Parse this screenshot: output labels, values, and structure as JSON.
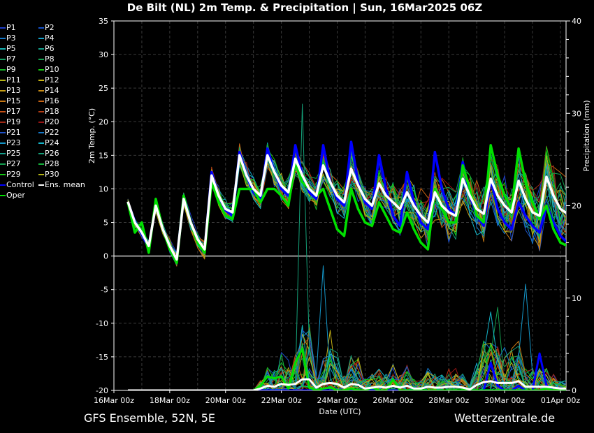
{
  "title": "De Bilt  (NL)  2m Temp. & Precipitation | Sun, 16Mar2025 06Z",
  "footer": {
    "left": "GFS Ensemble, 52N, 5E",
    "right": "Wetterzentrale.de"
  },
  "legend": [
    {
      "label": "P1",
      "color": "#1e3cc8"
    },
    {
      "label": "P2",
      "color": "#1450c8"
    },
    {
      "label": "P3",
      "color": "#1478c8"
    },
    {
      "label": "P4",
      "color": "#14a0c8"
    },
    {
      "label": "P5",
      "color": "#14b4b4"
    },
    {
      "label": "P6",
      "color": "#14a08c"
    },
    {
      "label": "P7",
      "color": "#14a064"
    },
    {
      "label": "P8",
      "color": "#14a050"
    },
    {
      "label": "P9",
      "color": "#14b428"
    },
    {
      "label": "P10",
      "color": "#14c814"
    },
    {
      "label": "P11",
      "color": "#b4b414"
    },
    {
      "label": "P12",
      "color": "#c8b414"
    },
    {
      "label": "P13",
      "color": "#c8a014"
    },
    {
      "label": "P14",
      "color": "#c88c14"
    },
    {
      "label": "P15",
      "color": "#c87814"
    },
    {
      "label": "P16",
      "color": "#c86414"
    },
    {
      "label": "P17",
      "color": "#c85014"
    },
    {
      "label": "P18",
      "color": "#b43c14"
    },
    {
      "label": "P19",
      "color": "#a02814"
    },
    {
      "label": "P20",
      "color": "#961414"
    },
    {
      "label": "P21",
      "color": "#1e50c8"
    },
    {
      "label": "P22",
      "color": "#1478c8"
    },
    {
      "label": "P23",
      "color": "#1496c8"
    },
    {
      "label": "P24",
      "color": "#14b4c8"
    },
    {
      "label": "P25",
      "color": "#14a08c"
    },
    {
      "label": "P26",
      "color": "#14a078"
    },
    {
      "label": "P27",
      "color": "#14a050"
    },
    {
      "label": "P28",
      "color": "#14b43c"
    },
    {
      "label": "P29",
      "color": "#14c814"
    },
    {
      "label": "P30",
      "color": "#b4b414"
    },
    {
      "label": "Control",
      "color": "#0000ff"
    },
    {
      "label": "Ens. mean",
      "color": "#ffffff"
    },
    {
      "label": "Oper",
      "color": "#00e000"
    }
  ],
  "chart_data": {
    "type": "line",
    "title": "De Bilt  (NL)  2m Temp. & Precipitation | Sun, 16Mar2025 06Z",
    "xlabel": "Date (UTC)",
    "ylabel": "2m Temp. (°C)",
    "y2label": "Precipitation (mm)",
    "ylim": [
      -20,
      35
    ],
    "y2lim": [
      0,
      40
    ],
    "yticks": [
      "35",
      "30",
      "25",
      "20",
      "15",
      "10",
      "5",
      "0",
      "-5",
      "-10",
      "-15",
      "-20"
    ],
    "y2ticks": [
      "40",
      "30",
      "20",
      "10",
      "0"
    ],
    "xticks": [
      "16Mar 00z",
      "18Mar 00z",
      "20Mar 00z",
      "22Mar 00z",
      "24Mar 00z",
      "26Mar 00z",
      "28Mar 00z",
      "30Mar 00z",
      "01Apr 00z"
    ],
    "x_start_day": 0.5,
    "x_step_hours": 6,
    "x_range_days": [
      0,
      16.2
    ],
    "grid": true,
    "temp": {
      "ens_mean": [
        8.1,
        5,
        3.5,
        1.5,
        7.5,
        4,
        1.5,
        -0.5,
        8.5,
        5,
        2.5,
        1,
        12,
        9,
        7,
        6.5,
        15,
        12,
        10,
        9,
        15,
        12.5,
        10.5,
        9.5,
        14.5,
        12,
        10,
        9,
        13.5,
        11,
        9,
        8,
        13,
        10.5,
        8.5,
        7.5,
        10.8,
        9,
        8,
        7,
        9.5,
        7.5,
        6,
        5,
        9.5,
        7.5,
        6.5,
        6,
        11.5,
        9,
        7,
        6.3,
        11.5,
        9,
        7.5,
        6.5,
        11.2,
        8.5,
        6.5,
        6,
        11.8,
        9,
        7,
        6.3
      ],
      "control": [
        8,
        5.2,
        3.2,
        1.2,
        7.8,
        4,
        1.2,
        -0.6,
        8.8,
        5,
        2.3,
        0.8,
        12.5,
        9,
        6.8,
        6,
        15.5,
        12,
        9.5,
        8.5,
        16,
        12.5,
        10,
        9,
        16.5,
        12,
        9.5,
        8.5,
        16.5,
        11,
        8.5,
        7.5,
        17,
        11,
        8,
        7,
        15,
        10,
        6,
        4.5,
        12.5,
        8,
        5,
        4,
        15.5,
        10,
        7,
        6,
        14,
        9,
        6,
        4.5,
        11.5,
        7,
        5,
        4,
        8,
        6,
        4.5,
        3.5,
        7.5,
        5,
        3,
        2
      ],
      "oper": [
        8,
        3.5,
        5,
        0.5,
        8.5,
        4,
        1,
        -1,
        9,
        5,
        2,
        0.5,
        11,
        8,
        6,
        5.5,
        10,
        10,
        10,
        8,
        10,
        10,
        9,
        7.5,
        14,
        11,
        10,
        9,
        10,
        7,
        4,
        3,
        10,
        7,
        5,
        4.5,
        8,
        6,
        4,
        3.5,
        6.5,
        4,
        2,
        1,
        10,
        7,
        5,
        5,
        13.5,
        10,
        6,
        5,
        16.5,
        12,
        9,
        7,
        16,
        11,
        8,
        5.5,
        7.5,
        4,
        2,
        1.5
      ],
      "member_spread": [
        0.6,
        5.5
      ]
    },
    "precip": {
      "ens_mean": [
        0,
        0,
        0,
        0,
        0,
        0,
        0,
        0,
        0,
        0,
        0,
        0,
        0,
        0,
        0,
        0,
        0,
        0,
        0,
        0.2,
        0.5,
        0.4,
        0.7,
        0.6,
        0.7,
        1.2,
        1.2,
        0.3,
        0.7,
        0.8,
        0.7,
        0.3,
        0.7,
        0.6,
        0.2,
        0.3,
        0.4,
        0.3,
        0.5,
        0.3,
        0.5,
        0.2,
        0.2,
        0.4,
        0.3,
        0.3,
        0.4,
        0.4,
        0.3,
        0.1,
        0.6,
        0.9,
        1,
        0.8,
        0.8,
        0.8,
        1,
        0.4,
        0.4,
        0.4,
        0.4,
        0.3,
        0.2,
        0.2
      ],
      "control": [
        0,
        0,
        0,
        0,
        0,
        0,
        0,
        0,
        0,
        0,
        0,
        0,
        0,
        0,
        0,
        0,
        0,
        0,
        0,
        0,
        0,
        0,
        0,
        0,
        0,
        0,
        0,
        0,
        0,
        0,
        0,
        0,
        0,
        0,
        0,
        0,
        0,
        0,
        0,
        0,
        0,
        0,
        0,
        0,
        0,
        0,
        0,
        0,
        0,
        0,
        0,
        0,
        3,
        0.5,
        0,
        0,
        0.5,
        0,
        0,
        4,
        0.5,
        0,
        0,
        0
      ],
      "oper": [
        0,
        0,
        0,
        0,
        0,
        0,
        0,
        0,
        0,
        0,
        0,
        0,
        0,
        0,
        0,
        0,
        0,
        0,
        0,
        0.5,
        1.5,
        1.3,
        1.5,
        0.2,
        3,
        4.5,
        0.3,
        0,
        0.2,
        0.3,
        0,
        0,
        0.2,
        0,
        0,
        0.3,
        0,
        0,
        1.2,
        0,
        0,
        0,
        0,
        0,
        0,
        0,
        0,
        0,
        0,
        0,
        0,
        0,
        0,
        0,
        0,
        0,
        0,
        0,
        0,
        0,
        0.2,
        0,
        0,
        0
      ],
      "member_peaks": [
        {
          "member": "P26",
          "index": 25,
          "value": 31
        },
        {
          "member": "P23",
          "index": 28,
          "value": 13.5
        },
        {
          "member": "P12",
          "index": 29,
          "value": 6.5
        },
        {
          "member": "P24",
          "index": 52,
          "value": 8.5
        },
        {
          "member": "P8",
          "index": 53,
          "value": 9
        },
        {
          "member": "P23",
          "index": 57,
          "value": 11.5
        }
      ]
    }
  }
}
